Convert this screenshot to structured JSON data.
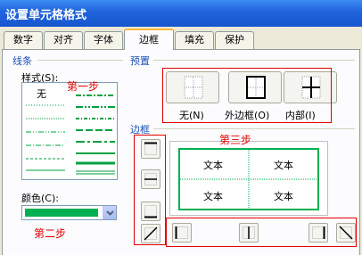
{
  "window": {
    "title": "设置单元格格式"
  },
  "tabs": [
    {
      "label": "数字"
    },
    {
      "label": "对齐"
    },
    {
      "label": "字体"
    },
    {
      "label": "边框",
      "active": true
    },
    {
      "label": "填充"
    },
    {
      "label": "保护"
    }
  ],
  "line_group": {
    "title": "线条",
    "style_label": "样式(S):",
    "style_none": "无",
    "color_label": "颜色(C):",
    "color_value": "#00B050"
  },
  "presets": {
    "title": "预置",
    "buttons": [
      {
        "label": "无(N)"
      },
      {
        "label": "外边框(O)"
      },
      {
        "label": "内部(I)"
      }
    ]
  },
  "border": {
    "title": "边框",
    "preview_cells": [
      "文本",
      "文本",
      "文本",
      "文本"
    ]
  },
  "annotations": {
    "step1": "第一步",
    "step2": "第二步",
    "step3": "第三步"
  },
  "colors": {
    "accent_red": "#E00000",
    "line_green": "#00B050",
    "group_blue": "#1E50B4"
  }
}
